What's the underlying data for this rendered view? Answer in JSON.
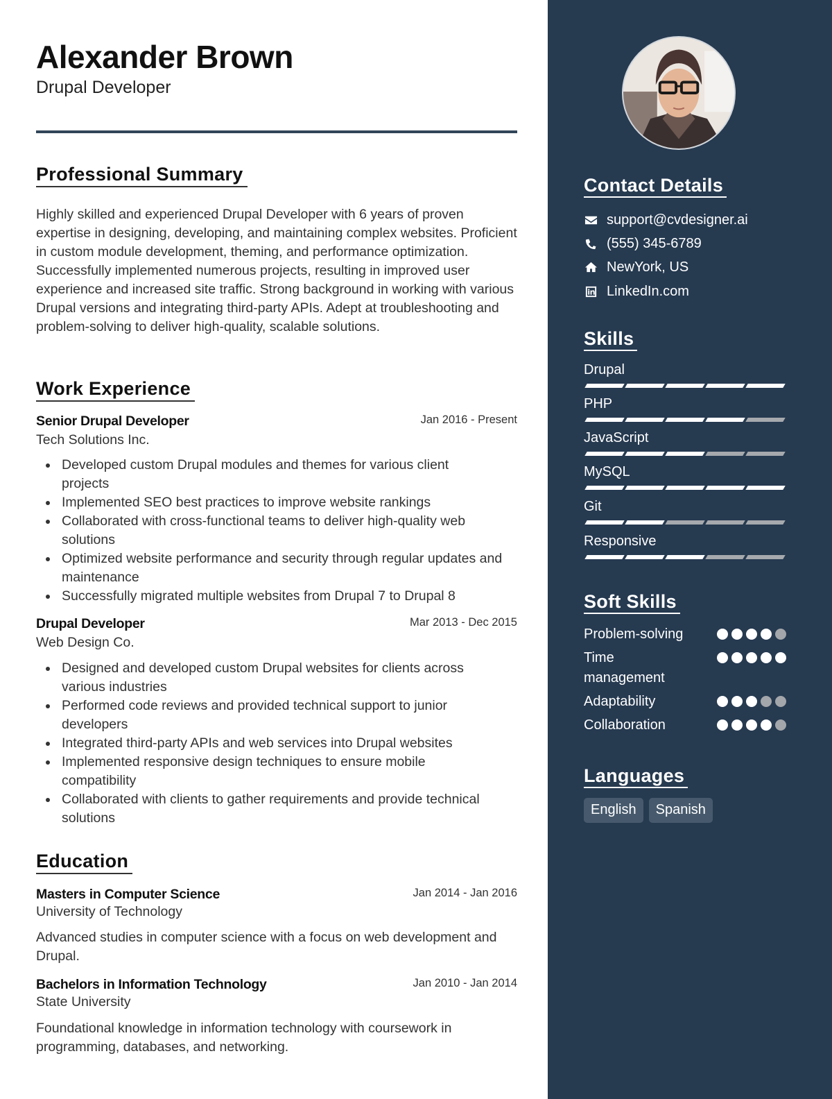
{
  "header": {
    "name": "Alexander Brown",
    "title": "Drupal Developer"
  },
  "summary": {
    "heading": "Professional Summary",
    "text": "Highly skilled and experienced Drupal Developer with 6 years of proven expertise in designing, developing, and maintaining complex websites. Proficient in custom module development, theming, and performance optimization. Successfully implemented numerous projects, resulting in improved user experience and increased site traffic. Strong background in working with various Drupal versions and integrating third-party APIs. Adept at troubleshooting and problem-solving to deliver high-quality, scalable solutions."
  },
  "experience": {
    "heading": "Work Experience",
    "jobs": [
      {
        "role": "Senior Drupal Developer",
        "dates": "Jan 2016 - Present",
        "company": "Tech Solutions Inc.",
        "bullets": [
          "Developed custom Drupal modules and themes for various client projects",
          "Implemented SEO best practices to improve website rankings",
          "Collaborated with cross-functional teams to deliver high-quality web solutions",
          "Optimized website performance and security through regular updates and maintenance",
          "Successfully migrated multiple websites from Drupal 7 to Drupal 8"
        ]
      },
      {
        "role": "Drupal Developer",
        "dates": "Mar 2013 - Dec 2015",
        "company": "Web Design Co.",
        "bullets": [
          "Designed and developed custom Drupal websites for clients across various industries",
          "Performed code reviews and provided technical support to junior developers",
          "Integrated third-party APIs and web services into Drupal websites",
          "Implemented responsive design techniques to ensure mobile compatibility",
          "Collaborated with clients to gather requirements and provide technical solutions"
        ]
      }
    ]
  },
  "education": {
    "heading": "Education",
    "items": [
      {
        "degree": "Masters in Computer Science",
        "dates": "Jan 2014 - Jan 2016",
        "school": "University of Technology",
        "description": "Advanced studies in computer science with a focus on web development and Drupal."
      },
      {
        "degree": "Bachelors in Information Technology",
        "dates": "Jan 2010 - Jan 2014",
        "school": "State University",
        "description": "Foundational knowledge in information technology with coursework in programming, databases, and networking."
      }
    ]
  },
  "sidebar": {
    "photo_alt": "profile-photo",
    "contact": {
      "heading": "Contact Details",
      "items": [
        {
          "icon": "envelope-icon",
          "text": "support@cvdesigner.ai"
        },
        {
          "icon": "phone-icon",
          "text": "(555) 345-6789"
        },
        {
          "icon": "home-icon",
          "text": "NewYork, US"
        },
        {
          "icon": "linkedin-icon",
          "text": "LinkedIn.com"
        }
      ]
    },
    "skills": {
      "heading": "Skills",
      "max": 5,
      "items": [
        {
          "label": "Drupal",
          "level": 5
        },
        {
          "label": "PHP",
          "level": 4
        },
        {
          "label": "JavaScript",
          "level": 3
        },
        {
          "label": "MySQL",
          "level": 5
        },
        {
          "label": "Git",
          "level": 2
        },
        {
          "label": "Responsive",
          "level": 3
        }
      ]
    },
    "soft_skills": {
      "heading": "Soft Skills",
      "max": 5,
      "items": [
        {
          "label": "Problem-solving",
          "level": 4
        },
        {
          "label": "Time management",
          "level": 5
        },
        {
          "label": "Adaptability",
          "level": 3
        },
        {
          "label": "Collaboration",
          "level": 4
        }
      ]
    },
    "languages": {
      "heading": "Languages",
      "items": [
        "English",
        "Spanish"
      ]
    }
  },
  "colors": {
    "sidebar_bg": "#263a50",
    "rule": "#324559",
    "level_on": "#ffffff",
    "level_off": "#a6a9ad",
    "chip_bg": "#475a6d"
  }
}
